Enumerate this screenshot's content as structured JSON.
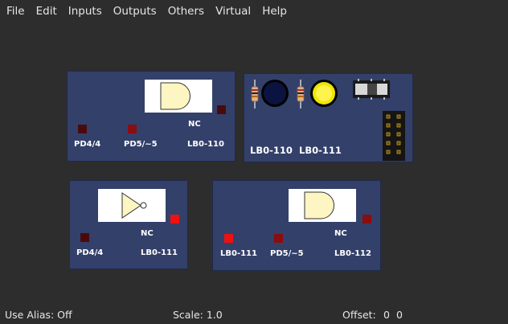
{
  "menu": [
    "File",
    "Edit",
    "Inputs",
    "Outputs",
    "Others",
    "Virtual",
    "Help"
  ],
  "modules": {
    "and1": {
      "labels": {
        "in1": "PD4/4",
        "in2": "PD5/~5",
        "nc": "NC",
        "out": "LB0-110"
      }
    },
    "board": {
      "labels": {
        "left": "LB0-110",
        "right": "LB0-111"
      }
    },
    "not1": {
      "labels": {
        "in1": "PD4/4",
        "nc": "NC",
        "out": "LB0-111"
      }
    },
    "and2": {
      "labels": {
        "in1": "LB0-111",
        "in2": "PD5/~5",
        "nc": "NC",
        "out": "LB0-112"
      }
    }
  },
  "status": {
    "alias": "Use Alias: Off",
    "scale": "Scale: 1.0",
    "offset_label": "Offset:",
    "offset_x": "0",
    "offset_y": "0"
  },
  "colors": {
    "module_bg": "#33406a",
    "gate_fill": "#fdf5c2",
    "led_off": "#4a0a0c",
    "led_dim": "#8a0d10",
    "led_on": "#ee1111",
    "yellow_button": "#f2e600",
    "blue_button": "#0b1340"
  },
  "icons": [
    "and-gate-icon",
    "not-gate-icon",
    "resistor-icon",
    "push-button-icon",
    "slide-switch-icon",
    "pin-header-icon"
  ]
}
